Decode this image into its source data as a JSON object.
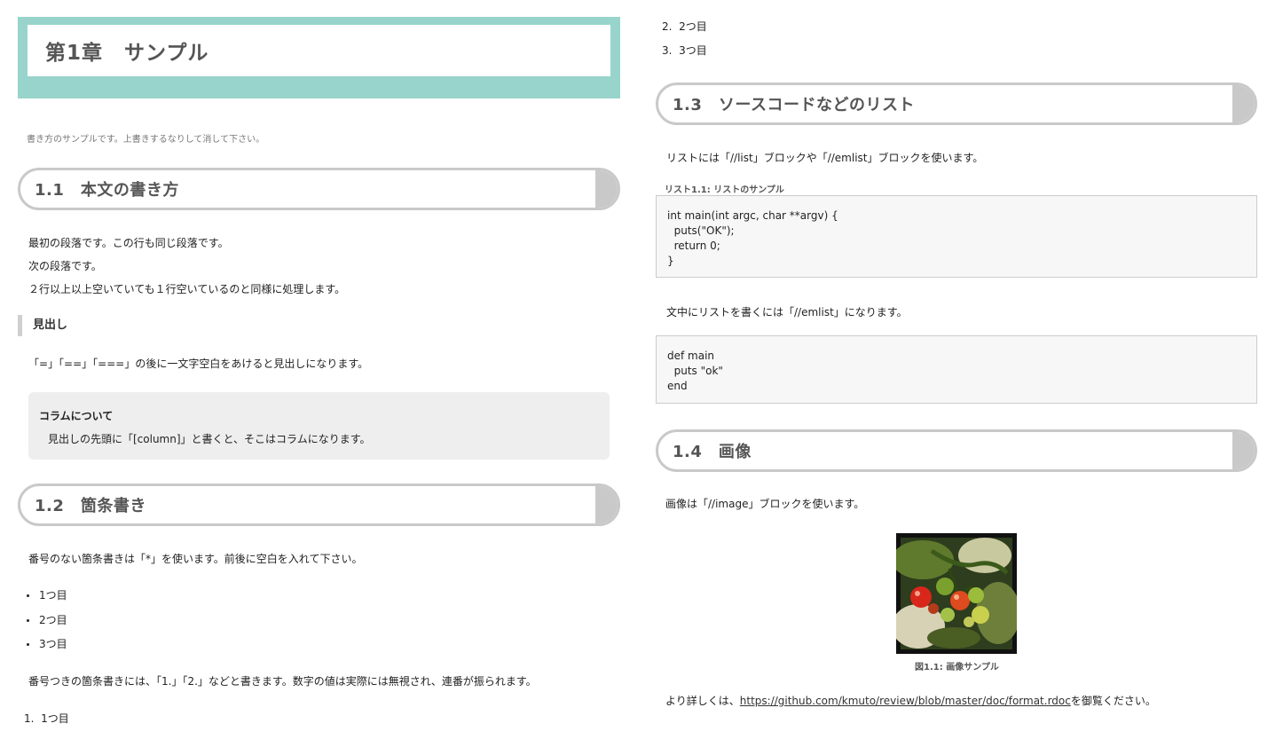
{
  "chapter": {
    "title": "第1章　サンプル"
  },
  "lead": "書き方のサンプルです。上書きするなりして消して下さい。",
  "sec1": {
    "title": "1.1　本文の書き方",
    "p1": "最初の段落です。この行も同じ段落です。",
    "p2": "次の段落です。",
    "p3": "２行以上以上空いていても１行空いているのと同様に処理します。",
    "subhead": "見出し",
    "p4": "「=」「==」「===」の後に一文字空白をあけると見出しになります。",
    "column_title": "コラムについて",
    "column_body": "見出しの先頭に「[column]」と書くと、そこはコラムになります。"
  },
  "sec2": {
    "title": "1.2　箇条書き",
    "p1": "番号のない箇条書きは「*」を使います。前後に空白を入れて下さい。",
    "bullets": [
      "1つ目",
      "2つ目",
      "3つ目"
    ],
    "p2": "番号つきの箇条書きには、「1.」「2.」などと書きます。数字の値は実際には無視され、連番が振られます。",
    "ordered": [
      {
        "num": "1.",
        "text": "1つ目"
      },
      {
        "num": "2.",
        "text": "2つ目"
      },
      {
        "num": "3.",
        "text": "3つ目"
      }
    ]
  },
  "sec3": {
    "title": "1.3　ソースコードなどのリスト",
    "p1": "リストには「//list」ブロックや「//emlist」ブロックを使います。",
    "list_caption": "リスト1.1: リストのサンプル",
    "code1": "int main(int argc, char **argv) {\n  puts(\"OK\");\n  return 0;\n}",
    "p2": "文中にリストを書くには「//emlist」になります。",
    "code2": "def main\n  puts \"ok\"\nend"
  },
  "sec4": {
    "title": "1.4　画像",
    "p1": "画像は「//image」ブロックを使います。",
    "figure_caption": "図1.1: 画像サンプル",
    "more_prefix": "より詳しくは、",
    "more_link": "https://github.com/kmuto/review/blob/master/doc/format.rdoc",
    "more_suffix": "を御覧ください。"
  }
}
